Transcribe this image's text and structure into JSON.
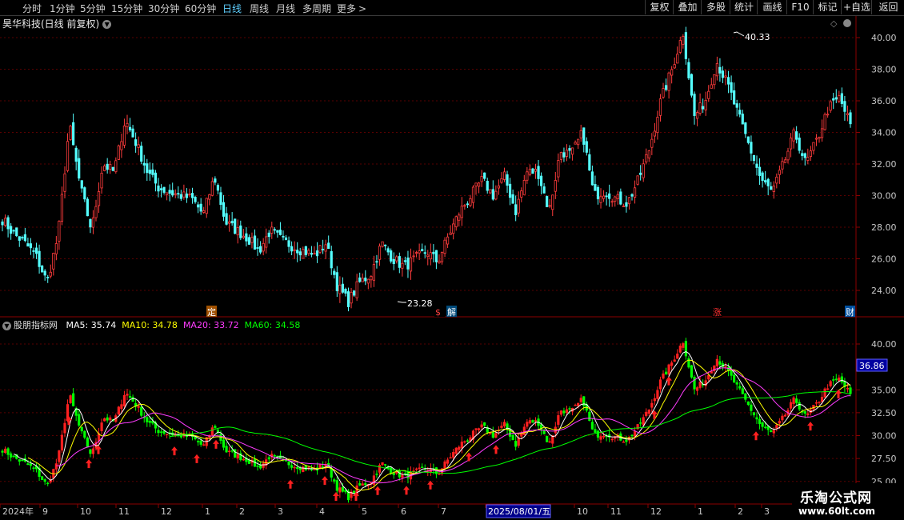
{
  "toolbar": {
    "timeframes": [
      "分时",
      "1分钟",
      "5分钟",
      "15分钟",
      "30分钟",
      "60分钟",
      "日线",
      "周线",
      "月线",
      "多周期",
      "更多"
    ],
    "active_timeframe": "日线",
    "more_arrow": ">",
    "buttons": [
      "复权",
      "叠加",
      "多股",
      "统计",
      "画线",
      "F10",
      "标记",
      "+自选",
      "返回"
    ]
  },
  "stock_title": "昊华科技(日线 前复权)",
  "indicator": {
    "name": "股朋指标网",
    "ma_labels": [
      {
        "text": "MA5: 35.74",
        "color": "#ffffff"
      },
      {
        "text": "MA10: 34.78",
        "color": "#ffff00"
      },
      {
        "text": "MA20: 33.72",
        "color": "#ff3cff"
      },
      {
        "text": "MA60: 34.58",
        "color": "#00ff00"
      }
    ],
    "current_value": "36.86"
  },
  "price_axis": {
    "upper_ticks": [
      "40.00",
      "38.00",
      "36.00",
      "34.00",
      "32.00",
      "30.00",
      "28.00",
      "26.00",
      "24.00"
    ],
    "lower_ticks": [
      "40.00",
      "35.00",
      "32.50",
      "30.00",
      "27.50",
      "25.00"
    ]
  },
  "annotations": {
    "high_label": "40.33",
    "low_label": "23.28",
    "event_markers": [
      {
        "text": "定",
        "bg": "#a05000",
        "color": "#ffffff"
      },
      {
        "text": "$",
        "bg": "#000000",
        "color": "#ff4040"
      },
      {
        "text": "解",
        "bg": "#004a7a",
        "color": "#ffffff"
      },
      {
        "text": "涨",
        "bg": "#000000",
        "color": "#ff3030"
      },
      {
        "text": "财",
        "bg": "#0050a0",
        "color": "#ffffff"
      }
    ]
  },
  "date_axis": {
    "labels": [
      "2024年",
      "9",
      "10",
      "11",
      "12",
      "1",
      "2",
      "3",
      "4",
      "5",
      "6",
      "7",
      "2025/08/01/五",
      "10",
      "11",
      "12",
      "1",
      "2",
      "3"
    ]
  },
  "watermark": {
    "line1": "乐淘公式网",
    "line2": "www.60lt.com"
  },
  "colors": {
    "up": "#ff3c3c",
    "down": "#54ffff",
    "grid": "#5a0000",
    "axis": "#8b0000",
    "axis_text": "#c8c8c8"
  },
  "chart_data": {
    "type": "candlestick",
    "x_range": [
      "2024-08",
      "2026-03"
    ],
    "ylim": [
      23,
      41
    ],
    "close_path": [
      28.5,
      27.6,
      27.0,
      26.2,
      24.5,
      27.5,
      34.5,
      30.5,
      27.8,
      32.0,
      31.5,
      34.8,
      33.3,
      31.5,
      30.5,
      30.2,
      30.0,
      29.8,
      28.8,
      31.2,
      28.3,
      27.8,
      27.3,
      26.5,
      27.8,
      27.2,
      26.8,
      26.5,
      26.2,
      27.0,
      24.3,
      23.28,
      24.5,
      25.0,
      27.0,
      26.0,
      25.5,
      26.0,
      26.5,
      25.8,
      27.5,
      29.0,
      30.0,
      31.0,
      30.0,
      31.2,
      29.0,
      31.5,
      31.5,
      29.0,
      32.8,
      32.6,
      34.0,
      30.0,
      30.3,
      29.8,
      29.5,
      31.0,
      33.0,
      36.0,
      38.0,
      40.33,
      35.0,
      36.0,
      38.5,
      37.0,
      35.0,
      33.0,
      31.0,
      30.2,
      32.0,
      34.0,
      32.0,
      33.5,
      35.5,
      36.2,
      34.5
    ]
  }
}
